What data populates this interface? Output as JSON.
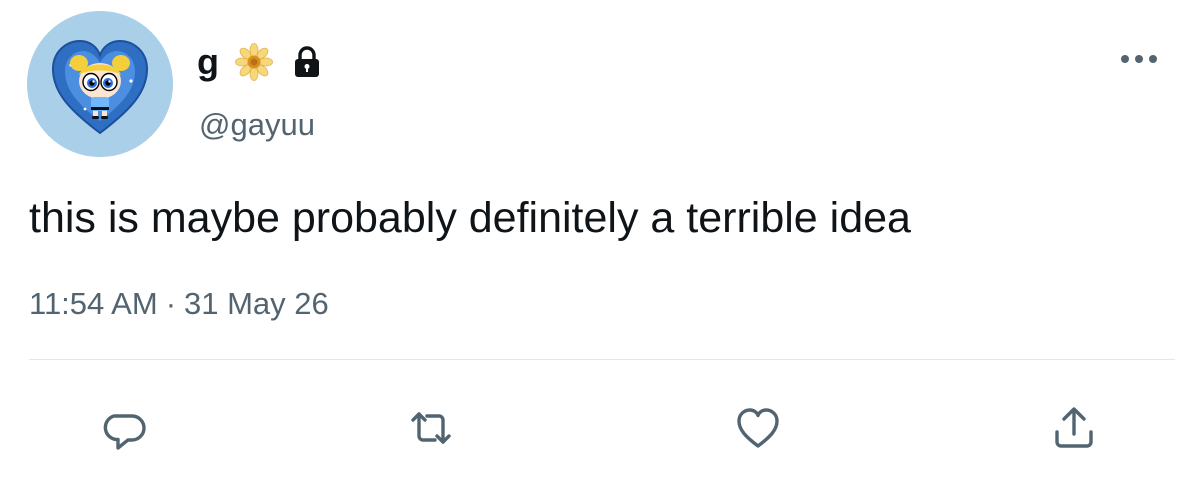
{
  "user": {
    "display_name": "g",
    "handle": "@gayuu",
    "badge_icon": "flower-icon",
    "protected_icon": "lock-icon",
    "avatar": "bubbles-avatar"
  },
  "tweet": {
    "text": "this is maybe probably definitely a terrible idea",
    "time": "11:54 AM",
    "separator": "·",
    "date": "31 May 26"
  },
  "actions": [
    "reply-icon",
    "retweet-icon",
    "like-icon",
    "share-icon"
  ],
  "colors": {
    "text_primary": "#0f1419",
    "text_secondary": "#536471",
    "avatar_bg": "#a9cfe9",
    "divider": "#e1e8ed"
  }
}
